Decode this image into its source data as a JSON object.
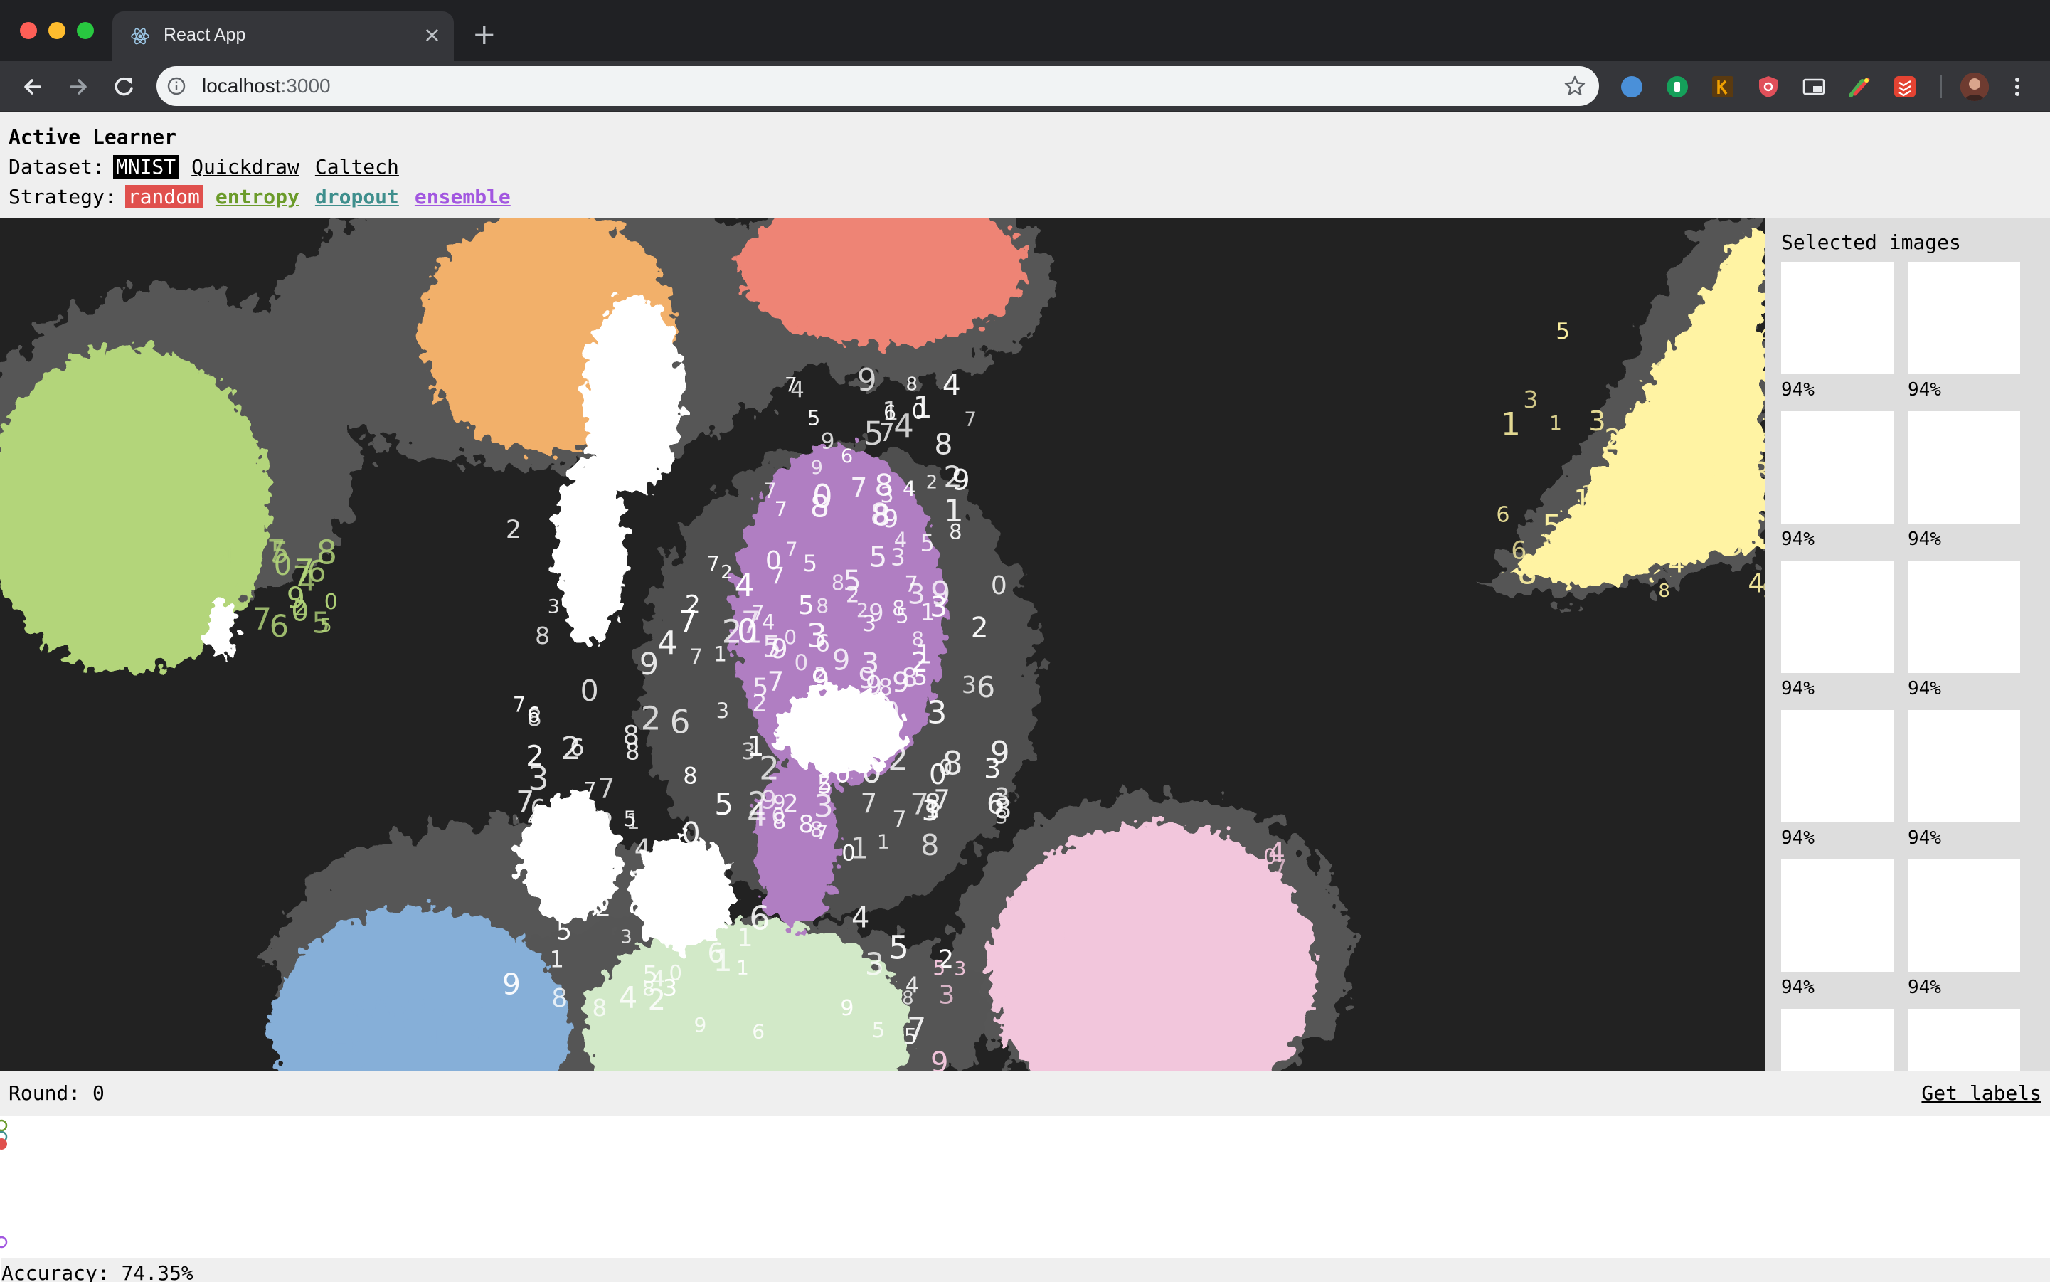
{
  "browser": {
    "tab_title": "React App",
    "tab_close": "×",
    "new_tab": "+",
    "url_host": "localhost",
    "url_port": ":3000",
    "extensions": [
      {
        "name": "safari-ext-icon",
        "color": "#4a90d9"
      },
      {
        "name": "grammarly-ext-icon",
        "color": "#15a05a"
      },
      {
        "name": "keepa-ext-icon",
        "color": "#f0a000"
      },
      {
        "name": "ublock-ext-icon",
        "color": "#e0505a"
      },
      {
        "name": "picture-in-picture-ext-icon",
        "color": "#e8eaed"
      },
      {
        "name": "colorpick-ext-icon",
        "color": "#e44"
      },
      {
        "name": "todoist-ext-icon",
        "color": "#e44332"
      }
    ]
  },
  "app": {
    "title": "Active Learner",
    "dataset_label": "Dataset:",
    "datasets": [
      "MNIST",
      "Quickdraw",
      "Caltech"
    ],
    "selected_dataset": "MNIST",
    "strategy_label": "Strategy:",
    "strategies": [
      "random",
      "entropy",
      "dropout",
      "ensemble"
    ],
    "selected_strategy": "random",
    "colors": {
      "random": "#e0504d",
      "entropy": "#6b9b2a",
      "dropout": "#3f8f8d",
      "ensemble": "#a257e0"
    }
  },
  "embedding": {
    "background": "#222222",
    "cluster_colors": {
      "zero": "#f2b06a",
      "one": "#fff3a3",
      "two": "#ee8474",
      "three": "#ffffff",
      "four": "#b3d57a",
      "five": "#86afd8",
      "six": "#d2e9c8",
      "seven": "#f2c6dc",
      "eight": "#b07ec2",
      "unlabeled": "#5c5c5c"
    },
    "glyphs": [
      "0",
      "1",
      "2",
      "3",
      "4",
      "5",
      "6",
      "7",
      "8",
      "9"
    ]
  },
  "side_panel": {
    "title": "Selected images",
    "thumbs": [
      "94%",
      "94%",
      "94%",
      "94%",
      "94%",
      "94%",
      "94%",
      "94%",
      "94%",
      "94%",
      "",
      ""
    ]
  },
  "footer": {
    "round_text": "Round: 0",
    "get_labels": "Get labels",
    "accuracy_text": "Accuracy: 74.35%",
    "strategy_markers": [
      "entropy",
      "dropout",
      "random",
      "ensemble"
    ]
  }
}
